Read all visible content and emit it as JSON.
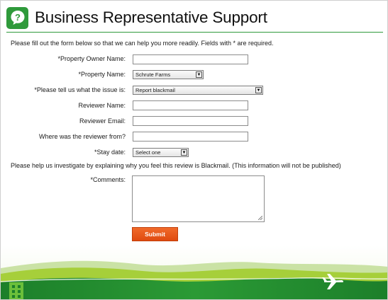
{
  "header": {
    "title": "Business Representative Support",
    "logo_icon": "question-bubble-icon",
    "accent_color": "#2f9a3b"
  },
  "form": {
    "intro": "Please fill out the form below so that we can help you more readily. Fields with * are required.",
    "property_owner_label": "*Property Owner Name:",
    "property_owner_value": "",
    "property_name_label": "*Property Name:",
    "property_name_selected": "Schrute Farms",
    "issue_label": "*Please tell us what the issue is:",
    "issue_selected": "Report blackmail",
    "reviewer_name_label": "Reviewer Name:",
    "reviewer_name_value": "",
    "reviewer_email_label": "Reviewer Email:",
    "reviewer_email_value": "",
    "reviewer_from_label": "Where was the reviewer from?",
    "reviewer_from_value": "",
    "stay_date_label": "*Stay date:",
    "stay_date_selected": "Select one",
    "investigate_text": "Please help us investigate by explaining why you feel this review is Blackmail. (This information will not be published)",
    "comments_label": "*Comments:",
    "comments_value": "",
    "submit_label": "Submit",
    "submit_color": "#e8581a"
  },
  "footer": {
    "building_icon": "building-icon",
    "plane_icon": "airplane-icon",
    "hill_color": "#1f8a2e",
    "light_hill_color": "#a6cf3a"
  }
}
